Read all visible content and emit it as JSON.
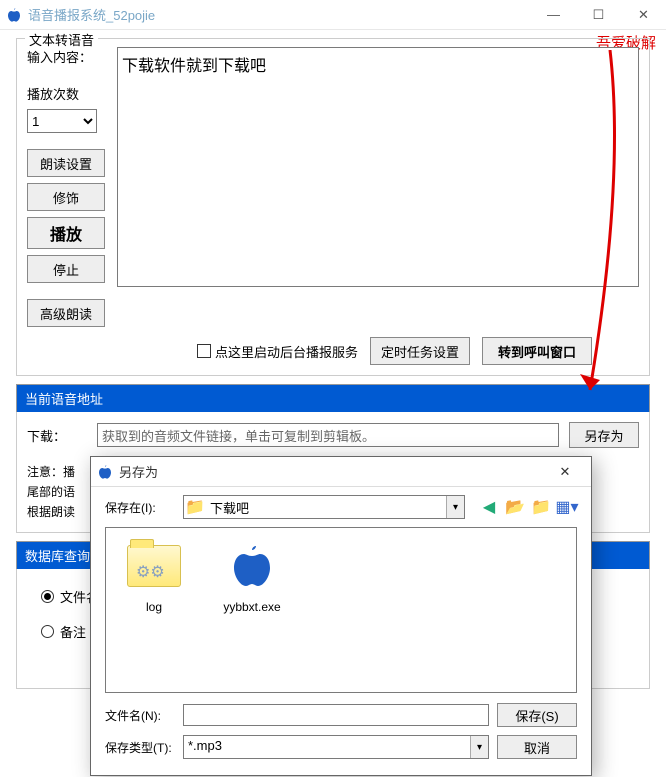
{
  "app": {
    "title": "语音播报系统_52pojie"
  },
  "watermark": "吾爱破解",
  "tts": {
    "group_label": "文本转语音",
    "input_label": "输入内容：",
    "play_count_label": "播放次数",
    "play_count_value": "1",
    "text_value": "下载软件就到下载吧",
    "btn_read_settings": "朗读设置",
    "btn_decorate": "修饰",
    "btn_play": "播放",
    "btn_stop": "停止",
    "btn_advanced": "高级朗读",
    "chk_start_service": "点这里启动后台播报服务",
    "btn_timer": "定时任务设置",
    "btn_goto_call": "转到呼叫窗口"
  },
  "addr": {
    "header": "当前语音地址",
    "dl_label": "下载：",
    "dl_value": "获取到的音频文件链接，单击可复制到剪辑板。",
    "btn_saveas": "另存为",
    "note_l1": "注意：播",
    "note_l2": "尾部的语",
    "note_l3": "根据朗读"
  },
  "db": {
    "header": "数据库查询",
    "radio_file": "文件名",
    "radio_note": "备注"
  },
  "saveas": {
    "title": "另存为",
    "save_in_label": "保存在(I):",
    "save_in_value": "下载吧",
    "files": [
      {
        "name": "log",
        "type": "folder"
      },
      {
        "name": "yybbxt.exe",
        "type": "exe"
      }
    ],
    "filename_label": "文件名(N):",
    "filename_value": "",
    "filetype_label": "保存类型(T):",
    "filetype_value": "*.mp3",
    "btn_save": "保存(S)",
    "btn_cancel": "取消"
  },
  "icons": {
    "apple": "apple-icon",
    "minimize": "—",
    "maximize": "☐",
    "close": "✕"
  }
}
